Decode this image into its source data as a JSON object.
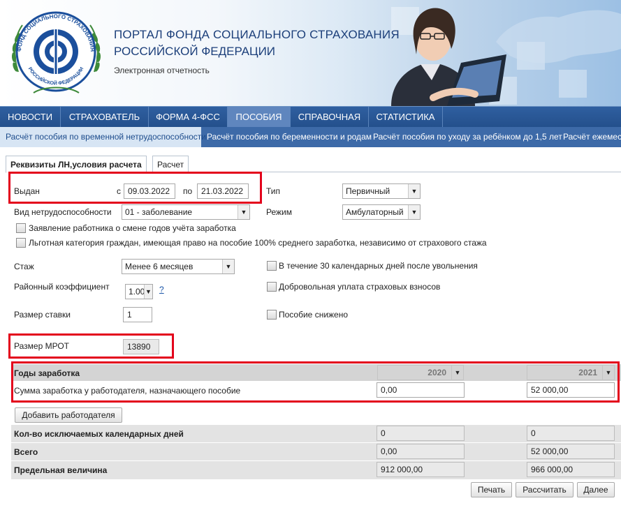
{
  "header": {
    "title_line1": "ПОРТАЛ ФОНДА СОЦИАЛЬНОГО СТРАХОВАНИЯ",
    "title_line2": "РОССИЙСКОЙ ФЕДЕРАЦИИ",
    "subtitle": "Электронная отчетность",
    "logo_text_top": "ФОНД СОЦИАЛЬНОГО СТРАХОВАНИЯ",
    "logo_text_bottom": "РОССИЙСКОЙ ФЕДЕРАЦИИ"
  },
  "nav": {
    "items": [
      "НОВОСТИ",
      "СТРАХОВАТЕЛЬ",
      "ФОРМА 4-ФСС",
      "ПОСОБИЯ",
      "СПРАВОЧНАЯ",
      "СТАТИСТИКА"
    ],
    "active": "ПОСОБИЯ"
  },
  "subnav": {
    "items": [
      "Расчёт пособия по временной нетрудоспособности",
      "Расчёт пособия по беременности и родам",
      "Расчёт пособия по уходу за ребёнком до 1,5 лет",
      "Расчёт ежемесячного"
    ],
    "active": "Расчёт пособия по временной нетрудоспособности"
  },
  "tabs": [
    "Реквизиты ЛН,условия расчета",
    "Расчет"
  ],
  "form": {
    "issued_label": "Выдан",
    "from_label": "с",
    "from_value": "09.03.2022",
    "to_label": "по",
    "to_value": "21.03.2022",
    "type_label": "Тип",
    "type_value": "Первичный",
    "disability_label": "Вид нетрудоспособности",
    "disability_value": "01 - заболевание",
    "mode_label": "Режим",
    "mode_value": "Амбулаторный",
    "cb_change_years": "Заявление работника о смене годов учёта заработка",
    "cb_privileged": "Льготная категория граждан, имеющая право на пособие 100% среднего заработка, независимо от страхового стажа",
    "experience_label": "Стаж",
    "experience_value": "Менее 6 месяцев",
    "cb_after_dismissal": "В течение 30 календарных дней после увольнения",
    "regional_label": "Районный коэффициент",
    "regional_value": "1.00",
    "help": "?",
    "cb_voluntary": "Добровольная уплата страховых взносов",
    "rate_label": "Размер ставки",
    "rate_value": "1",
    "cb_reduced": "Пособие снижено",
    "mrot_label": "Размер МРОТ",
    "mrot_value": "13890"
  },
  "earnings": {
    "years_label": "Годы заработка",
    "year1": "2020",
    "year2": "2021",
    "sum_label": "Сумма заработка у работодателя, назначающего пособие",
    "sum1": "0,00",
    "sum2": "52 000,00",
    "add_employer": "Добавить работодателя",
    "excluded_label": "Кол-во исключаемых календарных дней",
    "excluded1": "0",
    "excluded2": "0",
    "total_label": "Всего",
    "total1": "0,00",
    "total2": "52 000,00",
    "limit_label": "Предельная величина",
    "limit1": "912 000,00",
    "limit2": "966 000,00"
  },
  "buttons": {
    "print": "Печать",
    "calculate": "Рассчитать",
    "next": "Далее"
  },
  "colors": {
    "nav": "#2a5894",
    "subnav": "#3d6aa8",
    "highlight": "#e3001b"
  }
}
